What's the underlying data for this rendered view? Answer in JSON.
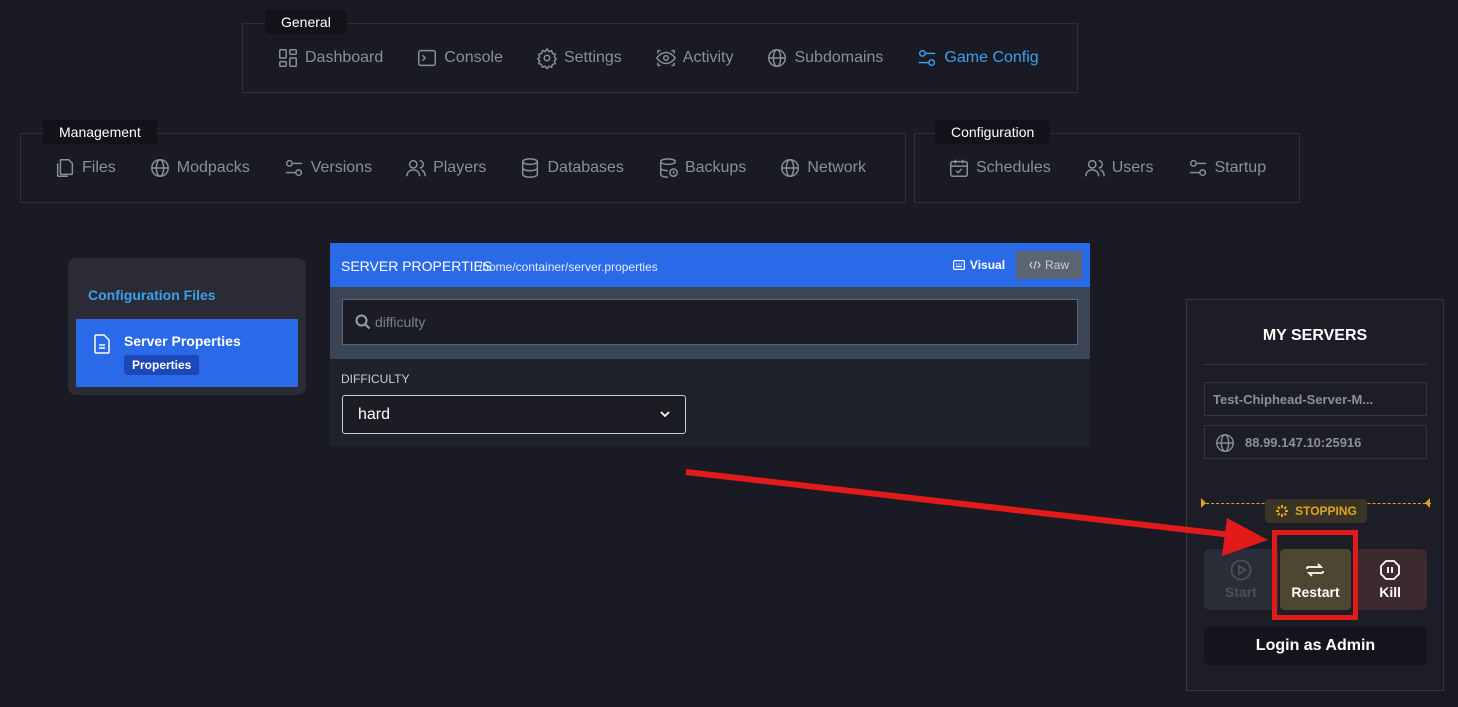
{
  "nav": {
    "general": {
      "title": "General",
      "items": [
        {
          "label": "Dashboard",
          "icon": "dashboard-icon"
        },
        {
          "label": "Console",
          "icon": "terminal-icon"
        },
        {
          "label": "Settings",
          "icon": "gear-icon"
        },
        {
          "label": "Activity",
          "icon": "activity-eye-icon"
        },
        {
          "label": "Subdomains",
          "icon": "globe-icon"
        },
        {
          "label": "Game Config",
          "icon": "sliders-icon",
          "active": true
        }
      ]
    },
    "management": {
      "title": "Management",
      "items": [
        {
          "label": "Files",
          "icon": "files-icon"
        },
        {
          "label": "Modpacks",
          "icon": "globe-icon"
        },
        {
          "label": "Versions",
          "icon": "sliders-icon"
        },
        {
          "label": "Players",
          "icon": "users-icon"
        },
        {
          "label": "Databases",
          "icon": "database-icon"
        },
        {
          "label": "Backups",
          "icon": "backup-icon"
        },
        {
          "label": "Network",
          "icon": "globe-icon"
        }
      ]
    },
    "configuration": {
      "title": "Configuration",
      "items": [
        {
          "label": "Schedules",
          "icon": "calendar-icon"
        },
        {
          "label": "Users",
          "icon": "users-icon"
        },
        {
          "label": "Startup",
          "icon": "sliders-icon"
        }
      ]
    }
  },
  "sidebar": {
    "title": "Configuration Files",
    "items": [
      {
        "label": "Server Properties",
        "badge": "Properties",
        "active": true
      }
    ]
  },
  "editor": {
    "title": "SERVER PROPERTIES",
    "path": "/home/container/server.properties",
    "visual_label": "Visual",
    "raw_label": "Raw",
    "search": {
      "placeholder": "difficulty"
    },
    "field_label": "DIFFICULTY",
    "field_value": "hard"
  },
  "servers": {
    "title": "MY SERVERS",
    "name": "Test-Chiphead-Server-M...",
    "ip": "88.99.147.10:25916",
    "status": "STOPPING",
    "buttons": {
      "start": "Start",
      "restart": "Restart",
      "kill": "Kill"
    },
    "login_admin": "Login as Admin"
  },
  "colors": {
    "background": "#191a24",
    "accent": "#2a6ae9",
    "active_nav": "#3aa0f0",
    "status_warning": "#e2a41c",
    "annotation": "#e21a1a"
  }
}
